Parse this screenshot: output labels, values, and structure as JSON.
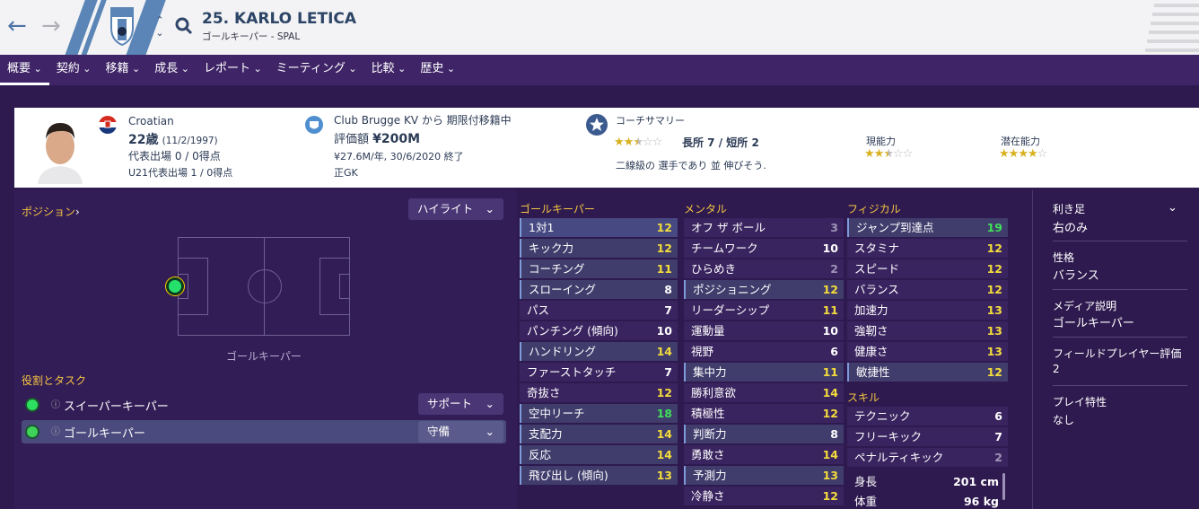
{
  "header": {
    "player_name": "25. KARLO LETICA",
    "subtitle": "ゴールキーパー - SPAL",
    "crest_text": "SPAL",
    "brand_color": "#5b85b6"
  },
  "tabs": [
    {
      "label": "概要",
      "active": true
    },
    {
      "label": "契約"
    },
    {
      "label": "移籍"
    },
    {
      "label": "成長"
    },
    {
      "label": "レポート"
    },
    {
      "label": "ミーティング"
    },
    {
      "label": "比較"
    },
    {
      "label": "歴史"
    }
  ],
  "info": {
    "nationality": "Croatian",
    "age": "22歳",
    "dob": "(11/2/1997)",
    "caps": "代表出場 0 / 0得点",
    "u21_caps": "U21代表出場 1 / 0得点",
    "loan": "Club Brugge KV から 期限付移籍中",
    "value_label": "評価額",
    "value": "¥200M",
    "wage": "¥27.6M/年, 30/6/2020 終了",
    "squad_status": "正GK",
    "coach_summary_title": "コーチサマリー",
    "coach_stars": 2.5,
    "strengths": "長所 7 / 短所 2",
    "summary_text": "二線級の 選手であり 並 伸びそう.",
    "current_ability_label": "現能力",
    "current_ability_stars": 2.5,
    "potential_ability_label": "潜在能力",
    "potential_ability_stars": 4
  },
  "positions": {
    "title": "ポジション",
    "highlight_dropdown": "ハイライト",
    "position_caption": "ゴールキーパー",
    "roles_title": "役割とタスク",
    "roles": [
      {
        "name": "スイーパーキーパー",
        "duty": "サポート"
      },
      {
        "name": "ゴールキーパー",
        "duty": "守備"
      }
    ]
  },
  "attributes": {
    "goalkeeping_title": "ゴールキーパー",
    "mental_title": "メンタル",
    "physical_title": "フィジカル",
    "technical_title": "スキル",
    "goalkeeping": [
      {
        "name": "1対1",
        "value": "12"
      },
      {
        "name": "キック力",
        "value": "12"
      },
      {
        "name": "コーチング",
        "value": "11"
      },
      {
        "name": "スローイング",
        "value": "8"
      },
      {
        "name": "パス",
        "value": "7"
      },
      {
        "name": "パンチング (傾向)",
        "value": "10"
      },
      {
        "name": "ハンドリング",
        "value": "14"
      },
      {
        "name": "ファーストタッチ",
        "value": "7"
      },
      {
        "name": "奇抜さ",
        "value": "12"
      },
      {
        "name": "空中リーチ",
        "value": "18"
      },
      {
        "name": "支配力",
        "value": "14"
      },
      {
        "name": "反応",
        "value": "14"
      },
      {
        "name": "飛び出し (傾向)",
        "value": "13"
      }
    ],
    "mental": [
      {
        "name": "オフ ザ ボール",
        "value": "3"
      },
      {
        "name": "チームワーク",
        "value": "10"
      },
      {
        "name": "ひらめき",
        "value": "2"
      },
      {
        "name": "ポジショニング",
        "value": "12"
      },
      {
        "name": "リーダーシップ",
        "value": "11"
      },
      {
        "name": "運動量",
        "value": "10"
      },
      {
        "name": "視野",
        "value": "6"
      },
      {
        "name": "集中力",
        "value": "11"
      },
      {
        "name": "勝利意欲",
        "value": "14"
      },
      {
        "name": "積極性",
        "value": "12"
      },
      {
        "name": "判断力",
        "value": "8"
      },
      {
        "name": "勇敢さ",
        "value": "14"
      },
      {
        "name": "予測力",
        "value": "13"
      },
      {
        "name": "冷静さ",
        "value": "12"
      }
    ],
    "physical": [
      {
        "name": "ジャンプ到達点",
        "value": "19"
      },
      {
        "name": "スタミナ",
        "value": "12"
      },
      {
        "name": "スピード",
        "value": "12"
      },
      {
        "name": "バランス",
        "value": "12"
      },
      {
        "name": "加速力",
        "value": "13"
      },
      {
        "name": "強靭さ",
        "value": "13"
      },
      {
        "name": "健康さ",
        "value": "13"
      },
      {
        "name": "敏捷性",
        "value": "12"
      }
    ],
    "technical": [
      {
        "name": "テクニック",
        "value": "6"
      },
      {
        "name": "フリーキック",
        "value": "7"
      },
      {
        "name": "ペナルティキック",
        "value": "2"
      }
    ],
    "height_label": "身長",
    "height": "201 cm",
    "weight_label": "体重",
    "weight": "96 kg"
  },
  "side": {
    "foot_label": "利き足",
    "foot": "右のみ",
    "personality_label": "性格",
    "personality": "バランス",
    "media_label": "メディア説明",
    "media": "ゴールキーパー",
    "outfield_label": "フィールドプレイヤー評価",
    "outfield": "2",
    "traits_label": "プレイ特性",
    "traits": "なし"
  }
}
